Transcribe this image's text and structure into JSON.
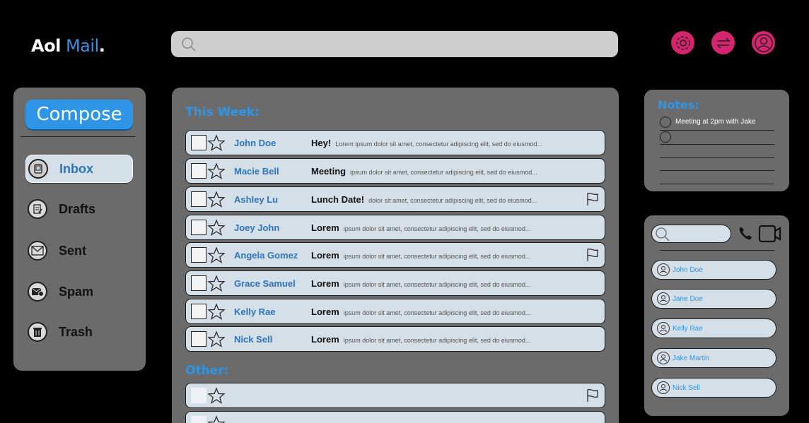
{
  "header": {
    "logo_aol": "Aol",
    "logo_mail": "Mail",
    "logo_dot": ".",
    "search_placeholder": ""
  },
  "sidebar": {
    "compose_label": "Compose",
    "items": [
      {
        "label": "Inbox",
        "icon": "inbox-icon",
        "active": true
      },
      {
        "label": "Drafts",
        "icon": "drafts-icon",
        "active": false
      },
      {
        "label": "Sent",
        "icon": "sent-icon",
        "active": false
      },
      {
        "label": "Spam",
        "icon": "spam-icon",
        "active": false
      },
      {
        "label": "Trash",
        "icon": "trash-icon",
        "active": false
      }
    ]
  },
  "main": {
    "this_week_title": "This Week:",
    "other_title": "Other:",
    "emails": [
      {
        "sender": "John Doe",
        "subject": "Hey!",
        "preview": "Lorem ipsum dolor sit amet, consectetur adipiscing elit, sed do eiusmod...",
        "flag": false
      },
      {
        "sender": "Macie Bell",
        "subject": "Meeting",
        "preview": "ipsum dolor sit amet, consectetur adipiscing elit, sed do eiusmod...",
        "flag": false
      },
      {
        "sender": "Ashley Lu",
        "subject": "Lunch Date!",
        "preview": "dolor sit amet, consectetur adipiscing elit, sed do eiusmod...",
        "flag": true
      },
      {
        "sender": "Joey John",
        "subject": "Lorem",
        "preview": "ipsum dolor sit amet, consectetur adipiscing elit, sed do eiusmod...",
        "flag": false
      },
      {
        "sender": "Angela Gomez",
        "subject": "Lorem",
        "preview": "ipsum dolor sit amet, consectetur adipiscing elit, sed do eiusmod...",
        "flag": true
      },
      {
        "sender": "Grace Samuel",
        "subject": "Lorem",
        "preview": "ipsum dolor sit amet, consectetur adipiscing elit, sed do eiusmod...",
        "flag": false
      },
      {
        "sender": "Kelly Rae",
        "subject": "Lorem",
        "preview": "ipsum dolor sit amet, consectetur adipiscing elit, sed do eiusmod...",
        "flag": false
      },
      {
        "sender": "Nick Sell",
        "subject": "Lorem",
        "preview": "ipsum dolor sit amet, consectetur adipiscing elit, sed do eiusmod...",
        "flag": false
      }
    ]
  },
  "notes": {
    "title": "Notes:",
    "items": [
      "Meeting at 2pm with Jake",
      ""
    ]
  },
  "contacts": {
    "search_placeholder": "",
    "list": [
      "John Doe",
      "Jane Doe",
      "Kelly Rae",
      "Jake Martin",
      "Nick Sell"
    ]
  },
  "colors": {
    "accent": "#2f95e6",
    "icon_pink": "#d6246e",
    "panel": "#6b6b6b",
    "row": "#d5dfe8"
  }
}
